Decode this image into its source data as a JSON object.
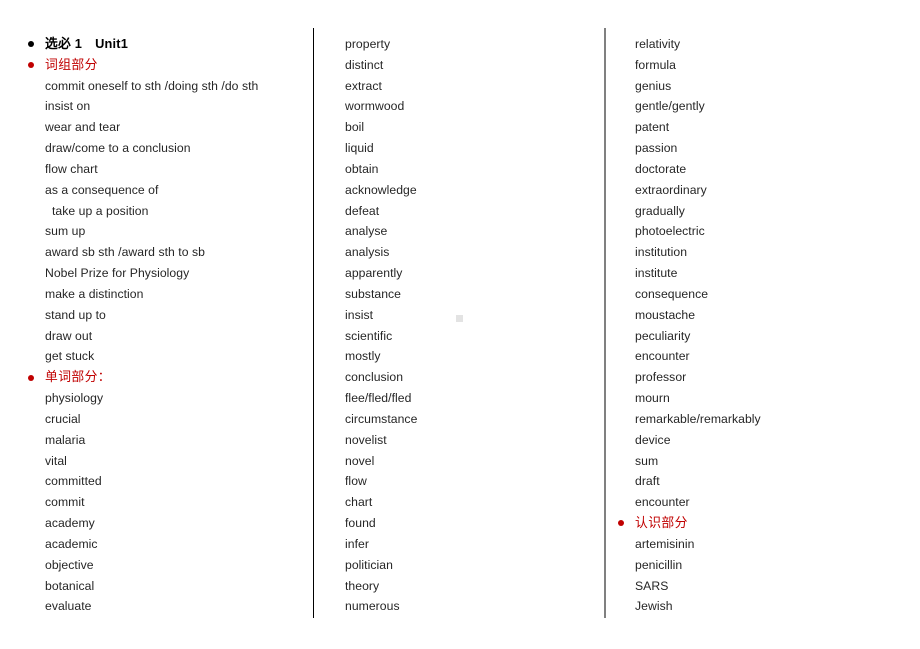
{
  "document": {
    "title": "选必 1　Unit1"
  },
  "colors": {
    "heading_red": "#C00000",
    "body_text": "#262626",
    "divider_dark": "#000000",
    "divider_light": "#808080",
    "artifact_gray": "#E3E3E3"
  },
  "columns": [
    {
      "id": "column-1",
      "rows": [
        {
          "kind": "heading",
          "bullet": "black",
          "text": "选必 1 Unit1"
        },
        {
          "kind": "heading",
          "bullet": "red",
          "text": "词组部分"
        },
        {
          "kind": "item",
          "text": "commit oneself to sth /doing sth /do sth"
        },
        {
          "kind": "item",
          "text": "insist on"
        },
        {
          "kind": "item",
          "text": "wear and tear"
        },
        {
          "kind": "item",
          "text": "draw/come to a conclusion"
        },
        {
          "kind": "item",
          "text": "flow chart"
        },
        {
          "kind": "item",
          "text": "as a consequence of"
        },
        {
          "kind": "item",
          "text": "take up a position",
          "indented": true
        },
        {
          "kind": "item",
          "text": "sum up"
        },
        {
          "kind": "item",
          "text": "award sb sth /award sth to sb"
        },
        {
          "kind": "item",
          "text": "Nobel Prize for Physiology"
        },
        {
          "kind": "item",
          "text": "make a distinction"
        },
        {
          "kind": "item",
          "text": "stand up to"
        },
        {
          "kind": "item",
          "text": "draw out"
        },
        {
          "kind": "item",
          "text": "get stuck"
        },
        {
          "kind": "heading",
          "bullet": "red",
          "text": "单词部分："
        },
        {
          "kind": "item",
          "text": "physiology"
        },
        {
          "kind": "item",
          "text": "crucial"
        },
        {
          "kind": "item",
          "text": "malaria"
        },
        {
          "kind": "item",
          "text": "vital"
        },
        {
          "kind": "item",
          "text": "committed"
        },
        {
          "kind": "item",
          "text": "commit"
        },
        {
          "kind": "item",
          "text": "academy"
        },
        {
          "kind": "item",
          "text": "academic"
        },
        {
          "kind": "item",
          "text": "objective"
        },
        {
          "kind": "item",
          "text": "botanical"
        },
        {
          "kind": "item",
          "text": "evaluate"
        }
      ]
    },
    {
      "id": "column-2",
      "rows": [
        {
          "kind": "item",
          "text": "property"
        },
        {
          "kind": "item",
          "text": "distinct"
        },
        {
          "kind": "item",
          "text": "extract"
        },
        {
          "kind": "item",
          "text": "wormwood"
        },
        {
          "kind": "item",
          "text": "boil"
        },
        {
          "kind": "item",
          "text": "liquid"
        },
        {
          "kind": "item",
          "text": "obtain"
        },
        {
          "kind": "item",
          "text": "acknowledge"
        },
        {
          "kind": "item",
          "text": "defeat"
        },
        {
          "kind": "item",
          "text": "analyse"
        },
        {
          "kind": "item",
          "text": "analysis"
        },
        {
          "kind": "item",
          "text": "apparently"
        },
        {
          "kind": "item",
          "text": "substance"
        },
        {
          "kind": "item",
          "text": "insist"
        },
        {
          "kind": "item",
          "text": "scientific"
        },
        {
          "kind": "item",
          "text": "mostly"
        },
        {
          "kind": "item",
          "text": "conclusion"
        },
        {
          "kind": "item",
          "text": "flee/fled/fled"
        },
        {
          "kind": "item",
          "text": "circumstance"
        },
        {
          "kind": "item",
          "text": "novelist"
        },
        {
          "kind": "item",
          "text": "novel"
        },
        {
          "kind": "item",
          "text": "flow"
        },
        {
          "kind": "item",
          "text": "chart"
        },
        {
          "kind": "item",
          "text": "found"
        },
        {
          "kind": "item",
          "text": "infer"
        },
        {
          "kind": "item",
          "text": "politician"
        },
        {
          "kind": "item",
          "text": "theory"
        },
        {
          "kind": "item",
          "text": "numerous"
        }
      ]
    },
    {
      "id": "column-3",
      "rows": [
        {
          "kind": "item",
          "text": "relativity"
        },
        {
          "kind": "item",
          "text": "formula"
        },
        {
          "kind": "item",
          "text": "genius"
        },
        {
          "kind": "item",
          "text": "gentle/gently"
        },
        {
          "kind": "item",
          "text": "patent"
        },
        {
          "kind": "item",
          "text": "passion"
        },
        {
          "kind": "item",
          "text": "doctorate"
        },
        {
          "kind": "item",
          "text": "extraordinary"
        },
        {
          "kind": "item",
          "text": "gradually"
        },
        {
          "kind": "item",
          "text": "photoelectric"
        },
        {
          "kind": "item",
          "text": "institution"
        },
        {
          "kind": "item",
          "text": "institute"
        },
        {
          "kind": "item",
          "text": "consequence"
        },
        {
          "kind": "item",
          "text": "moustache"
        },
        {
          "kind": "item",
          "text": "peculiarity"
        },
        {
          "kind": "item",
          "text": "encounter"
        },
        {
          "kind": "item",
          "text": "professor"
        },
        {
          "kind": "item",
          "text": "mourn"
        },
        {
          "kind": "item",
          "text": "remarkable/remarkably"
        },
        {
          "kind": "item",
          "text": "device"
        },
        {
          "kind": "item",
          "text": "sum"
        },
        {
          "kind": "item",
          "text": "draft"
        },
        {
          "kind": "item",
          "text": "encounter"
        },
        {
          "kind": "heading",
          "bullet": "red",
          "text": "认识部分"
        },
        {
          "kind": "item",
          "text": "artemisinin"
        },
        {
          "kind": "item",
          "text": "penicillin"
        },
        {
          "kind": "item",
          "text": "SARS"
        },
        {
          "kind": "item",
          "text": "Jewish"
        }
      ]
    }
  ]
}
